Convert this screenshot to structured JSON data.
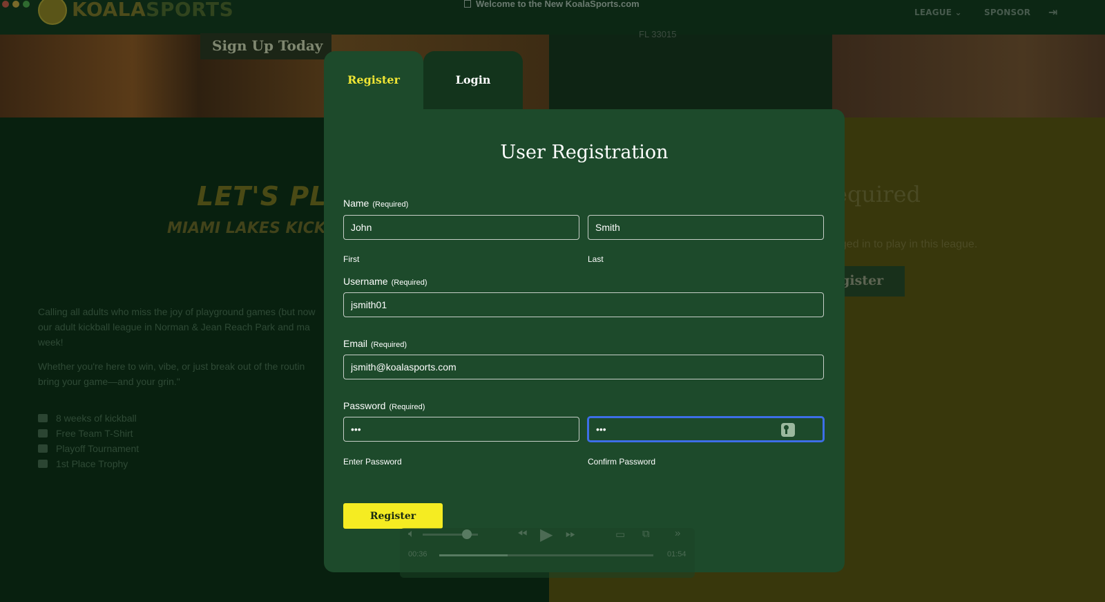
{
  "window": {
    "title": "Welcome to the New KoalaSports.com"
  },
  "header": {
    "logo_text_1": "KOALA",
    "logo_text_2": "SPORTS",
    "nav": {
      "league": "LEAGUE",
      "sponsor": "SPONSOR"
    }
  },
  "background": {
    "signup_chip": "Sign Up Today",
    "zip": "FL 33015",
    "lets_play": "LET'S PLAY",
    "miami": "MIAMI LAKES KICK",
    "para1_line1": "Calling all adults who miss the joy of playground games (but now",
    "para1_line2": "our adult kickball league in Norman & Jean Reach Park and ma",
    "para1_line3": "week!",
    "para2_line1": "Whether you're here to win, vibe, or just break out of the routin",
    "para2_line2": "bring your game—and your grin.\"",
    "bullets": [
      "8 weeks of kickball",
      "Free Team T-Shirt",
      "Playoff Tournament",
      "1st Place Trophy"
    ],
    "required_title": "equired",
    "required_sub": "gged in to play in this league.",
    "register_button": "egister"
  },
  "modal": {
    "tabs": {
      "register": "Register",
      "login": "Login"
    },
    "title": "User Registration",
    "required_tag": "(Required)",
    "name": {
      "label": "Name",
      "first_value": "John",
      "last_value": "Smith",
      "first_sub": "First",
      "last_sub": "Last"
    },
    "username": {
      "label": "Username",
      "value": "jsmith01"
    },
    "email": {
      "label": "Email",
      "value": "jsmith@koalasports.com"
    },
    "password": {
      "label": "Password",
      "value": "•••",
      "confirm_value": "•••",
      "enter_sub": "Enter Password",
      "confirm_sub": "Confirm Password"
    },
    "submit_label": "Register"
  },
  "media": {
    "elapsed": "00:36",
    "total": "01:54",
    "progress_fraction": 0.32,
    "volume_fraction": 0.8
  },
  "colors": {
    "modal_bg": "#1d4a2b",
    "accent_yellow": "#f5ec22",
    "focus_blue": "#3d6ee8"
  }
}
